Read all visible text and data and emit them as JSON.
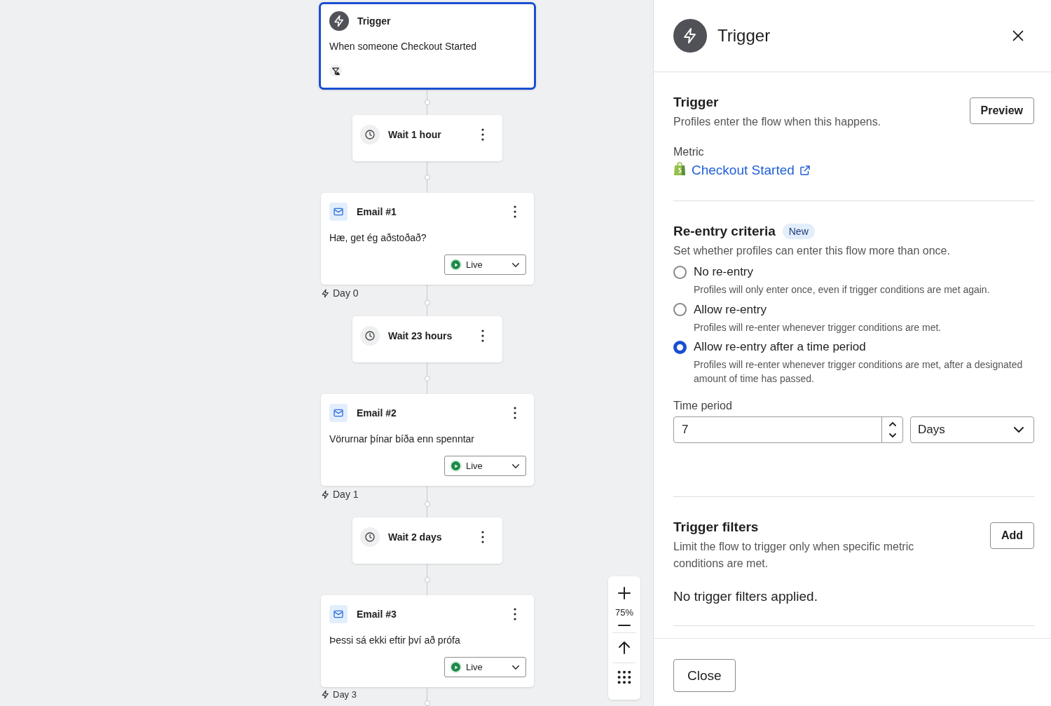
{
  "canvas": {
    "nodes": [
      {
        "kind": "trigger",
        "title": "Trigger",
        "description": "When someone Checkout Started",
        "selected": true
      },
      {
        "kind": "wait",
        "title": "Wait 1 hour"
      },
      {
        "kind": "email",
        "title": "Email #1",
        "subject": "Hæ, get ég aðstoðað?",
        "status": "Live",
        "day": "Day 0"
      },
      {
        "kind": "wait",
        "title": "Wait 23 hours"
      },
      {
        "kind": "email",
        "title": "Email #2",
        "subject": "Vörurnar þínar bíða enn spenntar",
        "status": "Live",
        "day": "Day 1"
      },
      {
        "kind": "wait",
        "title": "Wait 2 days"
      },
      {
        "kind": "email",
        "title": "Email #3",
        "subject": "Þessi sá ekki eftir því að prófa",
        "status": "Live",
        "day": "Day 3"
      }
    ],
    "zoom": "75%"
  },
  "panel": {
    "title": "Trigger",
    "trigger": {
      "title": "Trigger",
      "description": "Profiles enter the flow when this happens.",
      "button": "Preview",
      "metric_label": "Metric",
      "metric": "Checkout Started"
    },
    "reentry": {
      "title": "Re-entry criteria",
      "badge": "New",
      "description": "Set whether profiles can enter this flow more than once.",
      "options": [
        {
          "label": "No re-entry",
          "description": "Profiles will only enter once, even if trigger conditions are met again.",
          "selected": false
        },
        {
          "label": "Allow re-entry",
          "description": "Profiles will re-enter whenever trigger conditions are met.",
          "selected": false
        },
        {
          "label": "Allow re-entry after a time period",
          "description": "Profiles will re-enter whenever trigger conditions are met, after a designated amount of time has passed.",
          "selected": true
        }
      ],
      "time_period": {
        "label": "Time period",
        "value": "7",
        "unit": "Days"
      }
    },
    "filters": {
      "title": "Trigger filters",
      "description": "Limit the flow to trigger only when specific metric conditions are met.",
      "button": "Add",
      "empty": "No trigger filters applied."
    },
    "close_button": "Close"
  }
}
